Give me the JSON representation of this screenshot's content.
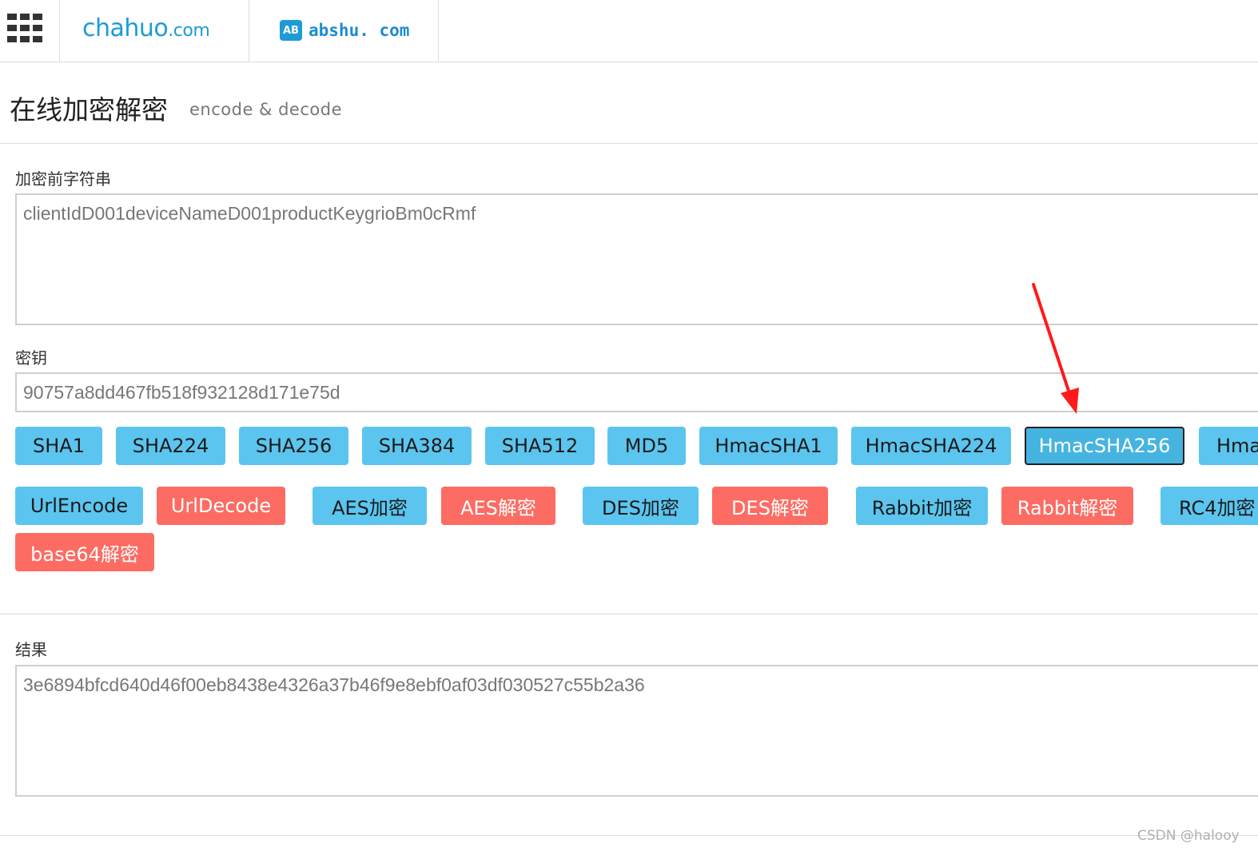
{
  "topbar": {
    "menu_icon": "grid-menu-icon",
    "site1_logo": "chahuo",
    "site1_logo_suffix": ".com",
    "site2_badge": "AB",
    "site2_logo": "abshu. com"
  },
  "header": {
    "title": "在线加密解密",
    "subtitle": "encode & decode"
  },
  "input": {
    "label": "加密前字符串",
    "value": "clientIdD001deviceNameD001productKeygrioBm0cRmf"
  },
  "key": {
    "label": "密钥",
    "value": "90757a8dd467fb518f932128d171e75d"
  },
  "buttons_row1": [
    {
      "label": "SHA1"
    },
    {
      "label": "SHA224"
    },
    {
      "label": "SHA256"
    },
    {
      "label": "SHA384"
    },
    {
      "label": "SHA512"
    },
    {
      "label": "MD5"
    },
    {
      "label": "HmacSHA1"
    },
    {
      "label": "HmacSHA224"
    },
    {
      "label": "HmacSHA256"
    },
    {
      "label": "Hma"
    }
  ],
  "buttons_row2": [
    {
      "label": "UrlEncode"
    },
    {
      "label": "UrlDecode"
    },
    {
      "label": "AES加密"
    },
    {
      "label": "AES解密"
    },
    {
      "label": "DES加密"
    },
    {
      "label": "DES解密"
    },
    {
      "label": "Rabbit加密"
    },
    {
      "label": "Rabbit解密"
    },
    {
      "label": "RC4加密"
    }
  ],
  "buttons_row3": [
    {
      "label": "base64解密"
    }
  ],
  "result": {
    "label": "结果",
    "value": "3e6894bfcd640d46f00eb8438e4326a37b46f9e8ebf0af03df030527c55b2a36"
  },
  "watermark": "CSDN @halooy",
  "colors": {
    "accent_blue": "#5bc5ef",
    "accent_red": "#fc6c62",
    "brand_blue": "#1e9bd7",
    "annotation_arrow": "#ff1a1a"
  }
}
